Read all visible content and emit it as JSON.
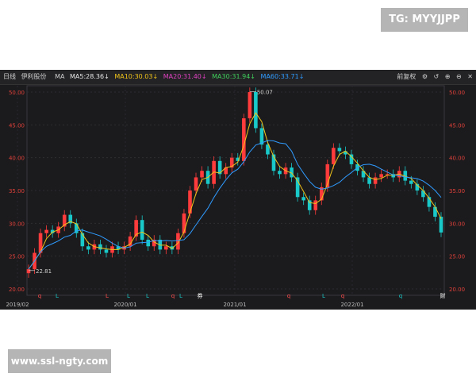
{
  "watermarks": {
    "top_right": "TG: MYYJJPP",
    "bottom_left": "www.ssl-ngty.com"
  },
  "toolbar": {
    "period": "日线",
    "stock_name": "伊利股份",
    "ma_label": "MA",
    "ma": [
      {
        "text": "MA5:28.36↓",
        "color": "#e6e6e6"
      },
      {
        "text": "MA10:30.03↓",
        "color": "#f0c419"
      },
      {
        "text": "MA20:31.40↓",
        "color": "#e040c0"
      },
      {
        "text": "MA30:31.94↓",
        "color": "#3fcf5a"
      },
      {
        "text": "MA60:33.71↓",
        "color": "#2f9bff"
      }
    ],
    "adjust_label": "前复权",
    "icons": [
      "settings-icon",
      "undo-icon",
      "zoom-in-icon",
      "zoom-out-icon",
      "close-icon"
    ]
  },
  "chart_data": {
    "type": "candlestick",
    "title": "",
    "y_ticks": [
      20.0,
      25.0,
      30.0,
      35.0,
      40.0,
      45.0,
      50.0
    ],
    "ylim": [
      20,
      50
    ],
    "x_ticks": [
      "2019/02",
      "2020/01",
      "2021/01",
      "2022/01"
    ],
    "annotations": {
      "max": "50.07",
      "min": "22.81"
    },
    "grid": true,
    "colors": {
      "up": "#ff3b3b",
      "down": "#19c8c8",
      "ma_short": "#f0c419",
      "ma_long": "#2f9bff"
    },
    "series": [
      {
        "name": "close",
        "values": [
          23.0,
          25.5,
          28.5,
          29.0,
          28.5,
          29.5,
          31.3,
          30.0,
          28.5,
          26.5,
          26.0,
          26.8,
          26.0,
          25.5,
          26.5,
          26.0,
          26.5,
          28.0,
          30.5,
          27.5,
          26.5,
          27.5,
          26.0,
          26.5,
          26.0,
          28.5,
          31.5,
          35.0,
          37.0,
          38.0,
          36.0,
          39.5,
          37.5,
          38.5,
          40.0,
          39.5,
          46.0,
          50.0,
          44.5,
          42.0,
          40.5,
          38.0,
          37.5,
          38.5,
          37.0,
          34.0,
          33.5,
          32.0,
          33.5,
          35.5,
          39.0,
          41.5,
          41.0,
          40.5,
          39.0,
          38.0,
          37.0,
          36.0,
          37.0,
          37.5,
          37.5,
          37.0,
          38.0,
          36.5,
          36.0,
          35.0,
          34.0,
          32.5,
          31.0,
          28.6
        ]
      }
    ]
  },
  "markers": [
    {
      "glyph": "q",
      "color": "#ff4d4d"
    },
    {
      "glyph": "L",
      "color": "#19c8c8"
    },
    {
      "glyph": "L",
      "color": "#ff4d4d"
    },
    {
      "glyph": "L",
      "color": "#19c8c8"
    },
    {
      "glyph": "L",
      "color": "#19c8c8"
    },
    {
      "glyph": "q",
      "color": "#ff4d4d"
    },
    {
      "glyph": "L",
      "color": "#19c8c8"
    },
    {
      "glyph": "券",
      "color": "#ffffff"
    },
    {
      "glyph": "q",
      "color": "#ff4d4d"
    },
    {
      "glyph": "L",
      "color": "#19c8c8"
    },
    {
      "glyph": "q",
      "color": "#ff4d4d"
    },
    {
      "glyph": "q",
      "color": "#19c8c8"
    },
    {
      "glyph": "财",
      "color": "#ffffff"
    }
  ]
}
